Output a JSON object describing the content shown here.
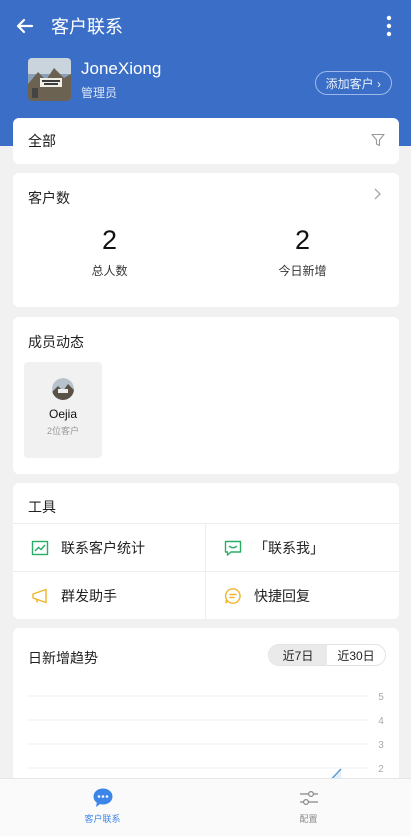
{
  "header": {
    "title": "客户联系",
    "back_icon": "arrow-left-icon",
    "more_icon": "more-vertical-icon",
    "bg_color": "#3b6fc7"
  },
  "profile": {
    "username": "JoneXiong",
    "role": "管理员",
    "add_button": "添加客户 ›"
  },
  "filter": {
    "label": "全部",
    "icon": "filter-icon"
  },
  "customer_count": {
    "title": "客户数",
    "total_value": "2",
    "total_label": "总人数",
    "today_value": "2",
    "today_label": "今日新增"
  },
  "members": {
    "title": "成员动态",
    "items": [
      {
        "name": "Oejia",
        "sub": "2位客户"
      }
    ]
  },
  "tools": {
    "title": "工具",
    "items": [
      {
        "label": "联系客户统计",
        "icon": "line-chart-icon",
        "color": "#2aae67"
      },
      {
        "label": "「联系我」",
        "icon": "message-icon",
        "color": "#2aae67"
      },
      {
        "label": "群发助手",
        "icon": "megaphone-icon",
        "color": "#f0b429"
      },
      {
        "label": "快捷回复",
        "icon": "quick-reply-icon",
        "color": "#f0b429"
      }
    ]
  },
  "trend": {
    "title": "日新增趋势",
    "tabs": [
      {
        "label": "近7日",
        "active": true
      },
      {
        "label": "近30日",
        "active": false
      }
    ]
  },
  "chart_data": {
    "type": "line",
    "y_ticks": [
      "5",
      "4",
      "3",
      "2"
    ],
    "ylim": [
      2,
      5
    ],
    "grid": true,
    "line_color": "#5b9bd8"
  },
  "tabbar": {
    "items": [
      {
        "label": "客户联系",
        "icon": "chat-bubble-icon",
        "active": true,
        "color": "#3b86e8"
      },
      {
        "label": "配置",
        "icon": "sliders-icon",
        "active": false,
        "color": "#888888"
      }
    ]
  }
}
